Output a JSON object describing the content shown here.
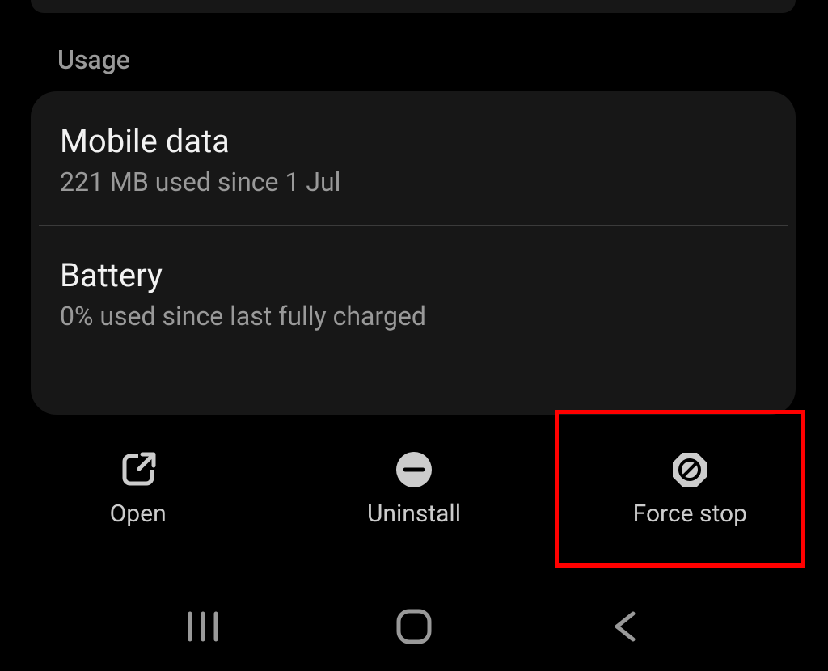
{
  "section": {
    "title": "Usage"
  },
  "rows": {
    "mobile_data": {
      "title": "Mobile data",
      "subtitle": "221 MB used since 1 Jul"
    },
    "battery": {
      "title": "Battery",
      "subtitle": "0% used since last fully charged"
    }
  },
  "actions": {
    "open": "Open",
    "uninstall": "Uninstall",
    "force_stop": "Force stop"
  }
}
